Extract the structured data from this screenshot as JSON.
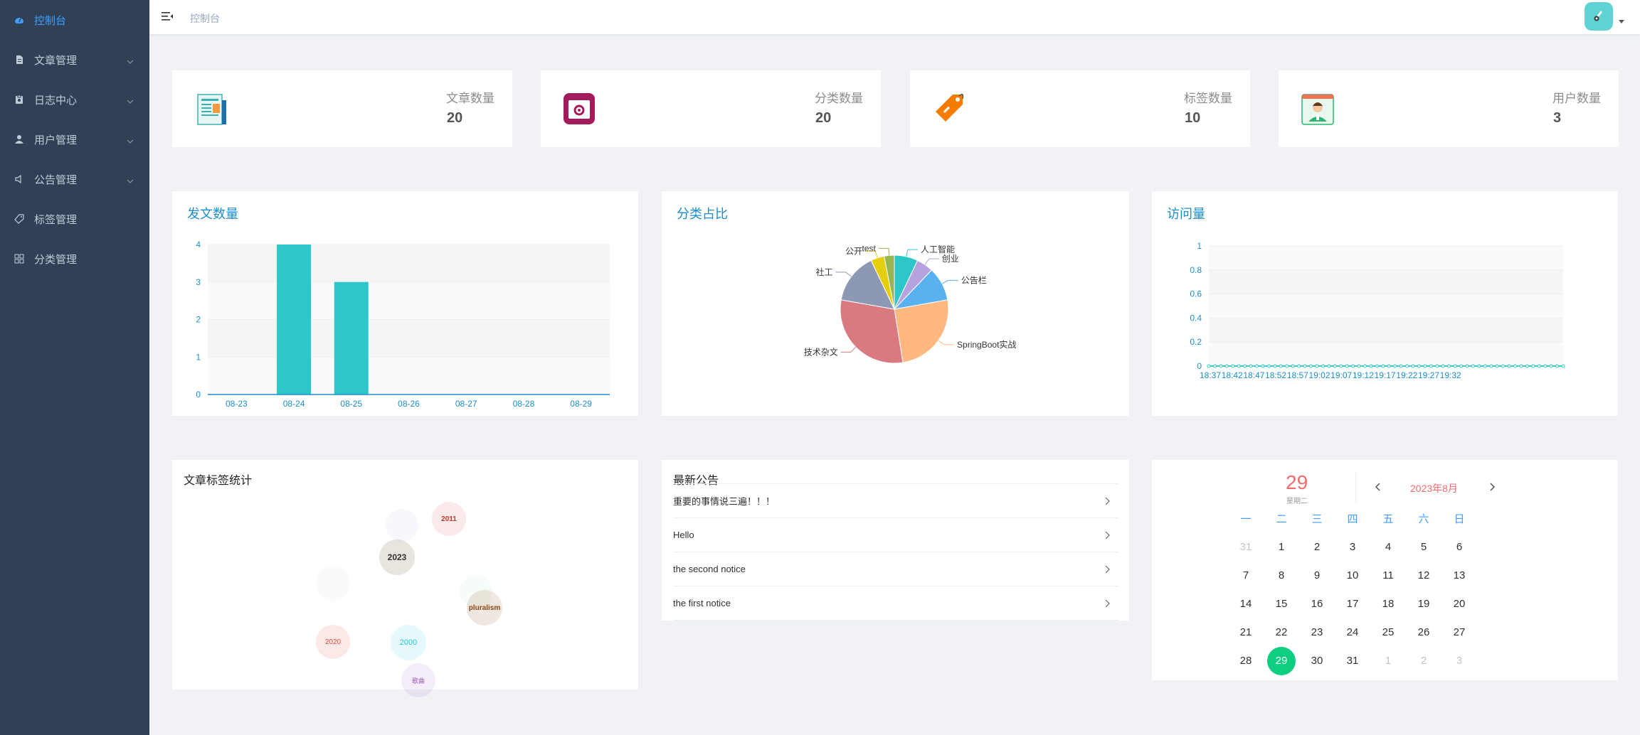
{
  "sidebar": {
    "items": [
      {
        "label": "控制台",
        "icon": "dashboard-icon",
        "active": true,
        "has_arrow": false
      },
      {
        "label": "文章管理",
        "icon": "document-icon",
        "active": false,
        "has_arrow": true
      },
      {
        "label": "日志中心",
        "icon": "log-icon",
        "active": false,
        "has_arrow": true
      },
      {
        "label": "用户管理",
        "icon": "user-icon",
        "active": false,
        "has_arrow": true
      },
      {
        "label": "公告管理",
        "icon": "speaker-icon",
        "active": false,
        "has_arrow": true
      },
      {
        "label": "标签管理",
        "icon": "tag-icon",
        "active": false,
        "has_arrow": false
      },
      {
        "label": "分类管理",
        "icon": "grid-icon",
        "active": false,
        "has_arrow": false
      }
    ]
  },
  "header": {
    "breadcrumb": "控制台"
  },
  "stats": [
    {
      "label": "文章数量",
      "value": "20",
      "icon": "newspaper-icon"
    },
    {
      "label": "分类数量",
      "value": "20",
      "icon": "category-box-icon"
    },
    {
      "label": "标签数量",
      "value": "10",
      "icon": "price-tag-icon"
    },
    {
      "label": "用户数量",
      "value": "3",
      "icon": "user-card-icon"
    }
  ],
  "panels": {
    "articles_title": "发文数量",
    "category_title": "分类占比",
    "visits_title": "访问量",
    "tags_title": "文章标签统计",
    "notices_title": "最新公告"
  },
  "notices": [
    {
      "text": "重要的事情说三遍！！！"
    },
    {
      "text": "Hello"
    },
    {
      "text": "the second notice"
    },
    {
      "text": "the first notice"
    }
  ],
  "tag_cloud": [
    {
      "text": "2011",
      "color": "#d9534f"
    },
    {
      "text": "2023",
      "color": "#333333"
    },
    {
      "text": "pluralism",
      "color": "#8b4513"
    },
    {
      "text": "2020",
      "color": "#e74c3c"
    },
    {
      "text": "2000",
      "color": "#26c6da"
    },
    {
      "text": "歌曲",
      "color": "#9b59b6"
    }
  ],
  "calendar": {
    "day": "29",
    "weekday": "星期二",
    "month_label": "2023年8月",
    "weekday_headers": [
      "一",
      "二",
      "三",
      "四",
      "五",
      "六",
      "日"
    ],
    "weeks": [
      [
        "31",
        "1",
        "2",
        "3",
        "4",
        "5",
        "6"
      ],
      [
        "7",
        "8",
        "9",
        "10",
        "11",
        "12",
        "13"
      ],
      [
        "14",
        "15",
        "16",
        "17",
        "18",
        "19",
        "20"
      ],
      [
        "21",
        "22",
        "23",
        "24",
        "25",
        "26",
        "27"
      ],
      [
        "28",
        "29",
        "30",
        "31",
        "1",
        "2",
        "3"
      ]
    ]
  },
  "chart_data": [
    {
      "type": "bar",
      "title": "发文数量",
      "categories": [
        "08-23",
        "08-24",
        "08-25",
        "08-26",
        "08-27",
        "08-28",
        "08-29"
      ],
      "values": [
        0,
        4,
        3,
        0,
        0,
        0,
        0
      ],
      "ylim": [
        0,
        4
      ],
      "yticks": [
        0,
        1,
        2,
        3,
        4
      ],
      "color": "#2ec7c9"
    },
    {
      "type": "pie",
      "title": "分类占比",
      "slices": [
        {
          "label": "人工智能",
          "value": 7,
          "color": "#2ec7c9"
        },
        {
          "label": "创业",
          "value": 5,
          "color": "#b6a2de"
        },
        {
          "label": "公告栏",
          "value": 10,
          "color": "#5ab1ef"
        },
        {
          "label": "SpringBoot实战",
          "value": 25,
          "color": "#ffb980"
        },
        {
          "label": "技术杂文",
          "value": 30,
          "color": "#d87a80"
        },
        {
          "label": "社工",
          "value": 15,
          "color": "#8d98b3"
        },
        {
          "label": "公开",
          "value": 4,
          "color": "#e5cf0d"
        },
        {
          "label": "test",
          "value": 3,
          "color": "#97b552"
        }
      ]
    },
    {
      "type": "line",
      "title": "访问量",
      "x_ticks": [
        "18:37",
        "18:42",
        "18:47",
        "18:52",
        "18:57",
        "19:02",
        "19:07",
        "19:12",
        "19:17",
        "19:22",
        "19:27",
        "19:32"
      ],
      "values": [
        0,
        0,
        0,
        0,
        0,
        0,
        0,
        0,
        0,
        0,
        0,
        0,
        0,
        0,
        0,
        0,
        0,
        0,
        0,
        0,
        0,
        0,
        0,
        0,
        0,
        0,
        0,
        0,
        0,
        0,
        0,
        0,
        0,
        0,
        0,
        0,
        0,
        0,
        0,
        0,
        0,
        0,
        0,
        0,
        0,
        0,
        0,
        0,
        0,
        0,
        0,
        0,
        0,
        0,
        0,
        0,
        0,
        0,
        0,
        0
      ],
      "ylim": [
        0,
        1
      ],
      "yticks": [
        "0",
        "0.2",
        "0.4",
        "0.6",
        "0.8",
        "1"
      ],
      "color": "#2ec7c9"
    }
  ]
}
